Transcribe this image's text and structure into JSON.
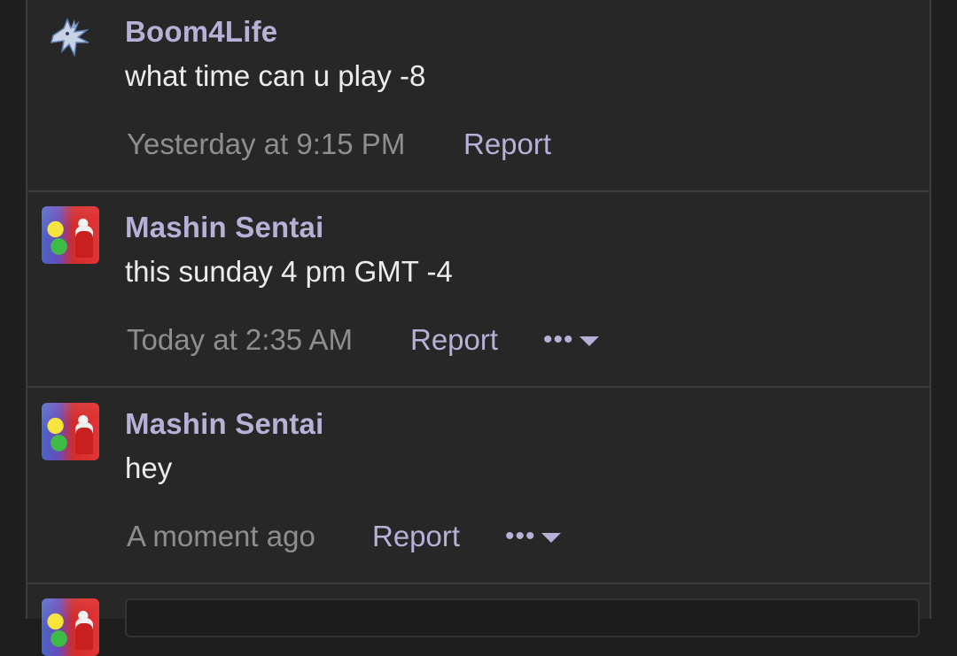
{
  "messages": [
    {
      "author": "Boom4Life",
      "avatar_icon": "dragon-avatar",
      "text": "what time can u play -8",
      "time": "Yesterday at 9:15 PM",
      "report_label": "Report"
    },
    {
      "author": "Mashin Sentai",
      "avatar_icon": "sentai-avatar",
      "text": "this sunday 4 pm GMT -4",
      "time": "Today at 2:35 AM",
      "report_label": "Report",
      "more_label": "•••"
    },
    {
      "author": "Mashin Sentai",
      "avatar_icon": "sentai-avatar",
      "text": "hey",
      "time": "A moment ago",
      "report_label": "Report",
      "more_label": "•••"
    }
  ],
  "reply": {
    "avatar_icon": "sentai-avatar",
    "placeholder": ""
  },
  "colors": {
    "background": "#272727",
    "username": "#b8b0d6",
    "message_text": "#ececec",
    "timestamp": "#8e8e8e",
    "divider": "#3c3c3c"
  }
}
